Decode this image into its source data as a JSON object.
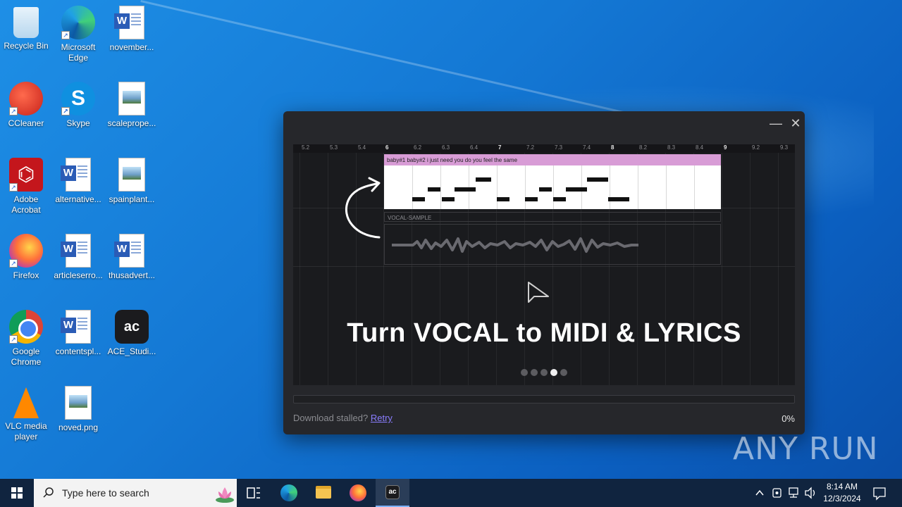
{
  "desktop": {
    "icons": [
      {
        "label": "Recycle Bin",
        "icon": "recycle-bin-icon"
      },
      {
        "label": "Microsoft Edge",
        "icon": "edge-icon"
      },
      {
        "label": "november...",
        "icon": "word-doc-icon"
      },
      {
        "label": "CCleaner",
        "icon": "ccleaner-icon"
      },
      {
        "label": "Skype",
        "icon": "skype-icon"
      },
      {
        "label": "scaleprope...",
        "icon": "image-file-icon"
      },
      {
        "label": "Adobe Acrobat",
        "icon": "acrobat-icon"
      },
      {
        "label": "alternative...",
        "icon": "word-doc-icon"
      },
      {
        "label": "spainplant...",
        "icon": "image-file-icon"
      },
      {
        "label": "Firefox",
        "icon": "firefox-icon"
      },
      {
        "label": "articleserro...",
        "icon": "word-doc-icon"
      },
      {
        "label": "thusadvert...",
        "icon": "word-doc-icon"
      },
      {
        "label": "Google Chrome",
        "icon": "chrome-icon"
      },
      {
        "label": "contentspl...",
        "icon": "word-doc-icon"
      },
      {
        "label": "ACE_Studi...",
        "icon": "ace-studio-icon"
      },
      {
        "label": "VLC media player",
        "icon": "vlc-icon"
      },
      {
        "label": "noved.png",
        "icon": "image-file-icon"
      }
    ]
  },
  "installer": {
    "minimize_glyph": "—",
    "close_glyph": "✕",
    "ruler_ticks": [
      "5.2",
      "5.3",
      "5.4",
      "6",
      "6.2",
      "6.3",
      "6.4",
      "7",
      "7.2",
      "7.3",
      "7.4",
      "8",
      "8.2",
      "8.3",
      "8.4",
      "9",
      "9.2",
      "9.3"
    ],
    "midi_lyrics": "baby#1 baby#2 i just need you do you feel the same",
    "vocal_track_label": "VOCAL-SAMPLE",
    "headline": "Turn VOCAL to MIDI & LYRICS",
    "slide_count": 5,
    "active_slide": 4,
    "progress_percent": 0,
    "status_text": "Download stalled?",
    "retry_label": "Retry",
    "percent_label": "0%"
  },
  "watermark": "ANY RUN",
  "taskbar": {
    "search_placeholder": "Type here to search",
    "apps": [
      "task-view-icon",
      "edge-icon",
      "file-explorer-icon",
      "firefox-icon",
      "ace-studio-icon"
    ],
    "active_app": "ace-studio-icon",
    "time": "8:14 AM",
    "date": "12/3/2024"
  }
}
